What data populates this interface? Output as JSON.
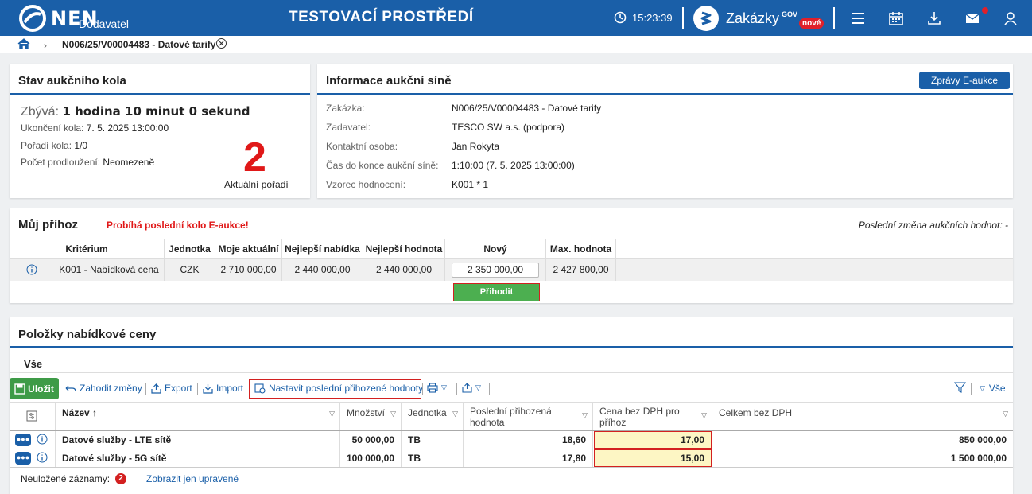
{
  "topbar": {
    "logo_text": "NEN",
    "logo_sub": "Dodavatel",
    "env_title": "TESTOVACÍ PROSTŘEDÍ",
    "clock": "15:23:39",
    "zakazky": "Zakázky",
    "gov": "GOV",
    "nove": "nové",
    "icons": [
      "menu-icon",
      "calendar-icon",
      "download-icon",
      "mail-icon",
      "user-icon"
    ],
    "brand_color": "#1a5fa8"
  },
  "breadcrumb": {
    "item": "N006/25/V00004483 - Datové tarify"
  },
  "stav": {
    "title": "Stav aukčního kola",
    "zbyva_label": "Zbývá:",
    "zbyva_value": "1 hodina 10 minut 0 sekund",
    "ukonceni_label": "Ukončení kola:",
    "ukonceni_value": "7. 5. 2025 13:00:00",
    "poradi_label": "Pořadí kola:",
    "poradi_value": "1/0",
    "pocet_label": "Počet prodloužení:",
    "pocet_value": "Neomezeně",
    "aktualni_poradi": "2",
    "aktualni_poradi_label": "Aktuální pořadí"
  },
  "info": {
    "title": "Informace aukční síně",
    "zpravy_button": "Zprávy E-aukce",
    "rows": [
      {
        "label": "Zakázka:",
        "value": "N006/25/V00004483 - Datové tarify"
      },
      {
        "label": "Zadavatel:",
        "value": "TESCO SW a.s. (podpora)"
      },
      {
        "label": "Kontaktní osoba:",
        "value": "Jan Rokyta"
      },
      {
        "label": "Čas do konce aukční síně:",
        "value": "1:10:00 (7. 5. 2025 13:00:00)"
      },
      {
        "label": "Vzorec hodnocení:",
        "value": "K001 * 1"
      }
    ]
  },
  "prihoz": {
    "title": "Můj příhoz",
    "alert": "Probíhá poslední kolo E-aukce!",
    "last_change": "Poslední změna aukčních hodnot: -",
    "headers": [
      "Kritérium",
      "Jednotka",
      "Moje aktuální",
      "Nejlepší nabídka",
      "Nejlepší hodnota",
      "Nový",
      "Max. hodnota"
    ],
    "row": {
      "kriterium": "K001 - Nabídková cena",
      "jednotka": "CZK",
      "moje": "2 710 000,00",
      "nejlepsi_nabidka": "2 440 000,00",
      "nejlepsi_hodnota": "2 440 000,00",
      "novy": "2 350 000,00",
      "max": "2 427 800,00"
    },
    "prihodit_button": "Přihodit"
  },
  "polozky": {
    "title": "Položky nabídkové ceny",
    "tab": "Vše",
    "toolbar": {
      "ulozit": "Uložit",
      "zahodit": "Zahodit změny",
      "export": "Export",
      "import": "Import",
      "nastavit": "Nastavit poslední přihozené hodnoty",
      "filter_all": "Vše"
    },
    "headers": {
      "nazev": "Název",
      "mnozstvi": "Množství",
      "jednotka": "Jednotka",
      "posledni": "Poslední přihozená hodnota",
      "cena": "Cena bez DPH pro příhoz",
      "celkem": "Celkem bez DPH"
    },
    "rows": [
      {
        "nazev": "Datové služby - LTE sítě",
        "mnozstvi": "50 000,00",
        "jednotka": "TB",
        "posledni": "18,60",
        "cena": "17,00",
        "celkem": "850 000,00"
      },
      {
        "nazev": "Datové služby - 5G sítě",
        "mnozstvi": "100 000,00",
        "jednotka": "TB",
        "posledni": "17,80",
        "cena": "15,00",
        "celkem": "1 500 000,00"
      }
    ],
    "footer_label": "Neuložené záznamy:",
    "footer_count": "2",
    "footer_link": "Zobrazit jen upravené"
  }
}
